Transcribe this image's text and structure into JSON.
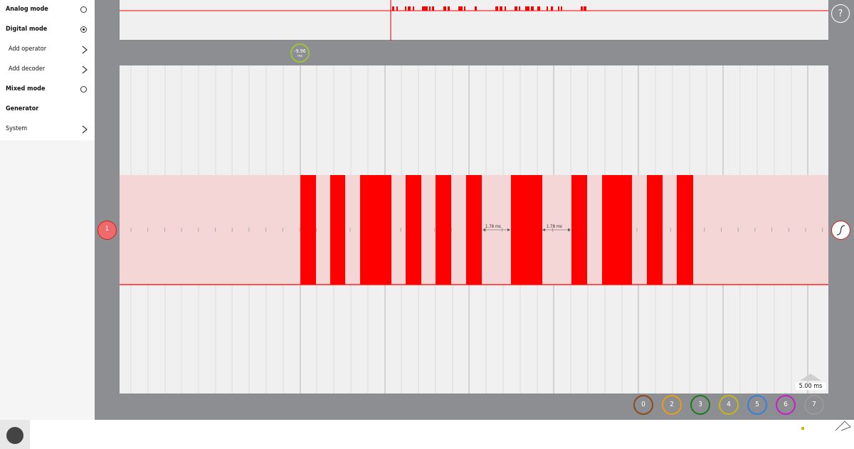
{
  "sidebar": {
    "items": [
      {
        "label": "Analog mode",
        "kind": "radio",
        "selected": false
      },
      {
        "label": "Digital mode",
        "kind": "radio",
        "selected": true
      },
      {
        "label": "Add operator",
        "kind": "submenu",
        "sub": true
      },
      {
        "label": "Add decoder",
        "kind": "submenu",
        "sub": true
      },
      {
        "label": "Mixed mode",
        "kind": "radio",
        "selected": false
      },
      {
        "label": "Generator",
        "kind": "header"
      },
      {
        "label": "System",
        "kind": "submenu",
        "sub": false
      }
    ]
  },
  "trigger_position": {
    "value": "-9.96",
    "unit": "ms"
  },
  "measurements": [
    "1.78 ms",
    "1.78 ms"
  ],
  "timebase": "5.00 ms",
  "channel_label": "1",
  "help_icon": "question-icon",
  "trigger_edge_icon": "rising-edge-icon",
  "channels": [
    {
      "label": "0",
      "color": "#8a4b1e"
    },
    {
      "label": "2",
      "color": "#e89c1a"
    },
    {
      "label": "3",
      "color": "#1e7a1e"
    },
    {
      "label": "4",
      "color": "#c8b41e"
    },
    {
      "label": "5",
      "color": "#3a7fd9"
    },
    {
      "label": "6",
      "color": "#c81ec8"
    },
    {
      "label": "7",
      "color": "#999999"
    }
  ],
  "colors": {
    "signal": "#ff0000",
    "signal_band": "#f5d6d6",
    "trigger_marker": "#9dc23a"
  }
}
